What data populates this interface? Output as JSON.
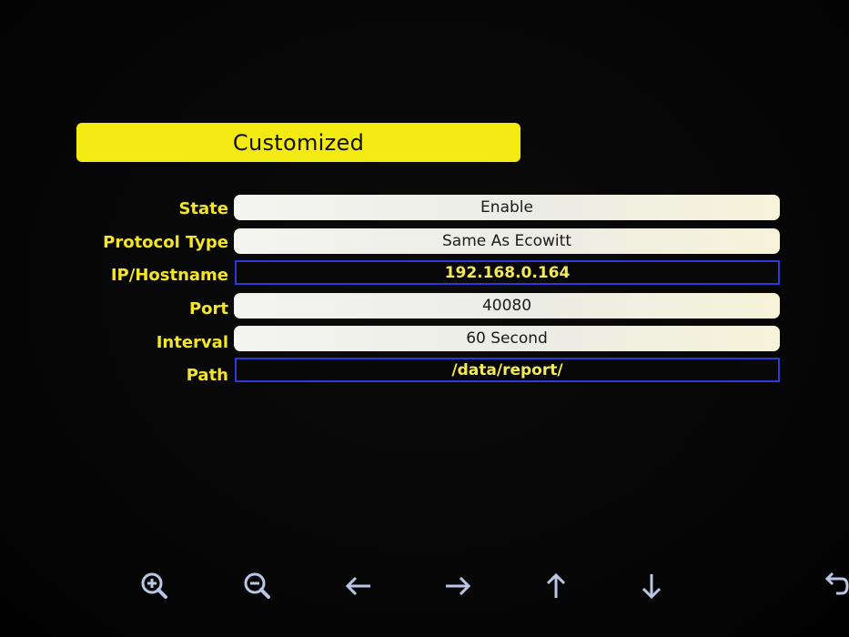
{
  "title": "Customized",
  "fields": {
    "state": {
      "label": "State",
      "value": "Enable"
    },
    "protocol_type": {
      "label": "Protocol Type",
      "value": "Same As Ecowitt"
    },
    "ip_hostname": {
      "label": "IP/Hostname",
      "value": "192.168.0.164"
    },
    "port": {
      "label": "Port",
      "value": "40080"
    },
    "interval": {
      "label": "Interval",
      "value": "60 Second"
    },
    "path": {
      "label": "Path",
      "value": "/data/report/"
    }
  },
  "toolbar": {
    "icons": [
      "zoom-in-icon",
      "zoom-out-icon",
      "arrow-left-icon",
      "arrow-right-icon",
      "arrow-up-icon",
      "arrow-down-icon",
      "return-icon"
    ]
  },
  "colors": {
    "title_bar": "#f2ea12",
    "label_text": "#f4e52a",
    "input_border": "#2a3bd8",
    "icon": "#b9c6e6"
  }
}
